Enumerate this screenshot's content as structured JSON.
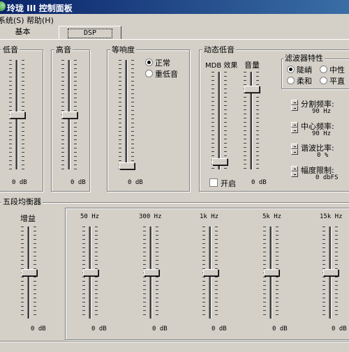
{
  "window": {
    "title": "玲珑 III 控制面板"
  },
  "menu": {
    "system": "系统(S)",
    "help": "帮助(H)"
  },
  "tabs": {
    "basic": "基本",
    "dsp": "DSP"
  },
  "bass": {
    "label": "低音",
    "value": "0 dB",
    "level": 0.5
  },
  "treble": {
    "label": "高音",
    "value": "0 dB",
    "level": 0.5
  },
  "loudness": {
    "label": "等响度",
    "value": "0 dB",
    "level": 0.0,
    "option_normal": "正常",
    "option_heavy_bass": "重低音",
    "selected": "正常"
  },
  "dyn_bass": {
    "label": "动态低音",
    "mdb_label": "MDB 效果",
    "volume_label": "音量",
    "enable_label": "开启",
    "enabled": false,
    "value": "0 dB",
    "mdb_level": 0.05,
    "volume_level": 0.85
  },
  "filter": {
    "label": "滤波器特性",
    "options": [
      "陡峭",
      "中性",
      "柔和",
      "平直"
    ],
    "selected": "陡峭",
    "crossover_label": "分割频率:",
    "crossover_value": "90 Hz",
    "center_label": "中心频率:",
    "center_value": "90 Hz",
    "harmonic_label": "谐波比率:",
    "harmonic_value": "0 %",
    "limit_label": "幅度限制:",
    "limit_value": "0 dbFS"
  },
  "eq": {
    "label": "五段均衡器",
    "gain": {
      "label": "增益",
      "value": "0 dB",
      "level": 0.5
    },
    "bands": [
      {
        "label": "50 Hz",
        "value": "0 dB",
        "level": 0.5
      },
      {
        "label": "300 Hz",
        "value": "0 dB",
        "level": 0.5
      },
      {
        "label": "1k Hz",
        "value": "0 dB",
        "level": 0.5
      },
      {
        "label": "5k Hz",
        "value": "0 dB",
        "level": 0.5
      },
      {
        "label": "15k Hz",
        "value": "0 dB",
        "level": 0.5
      }
    ]
  }
}
